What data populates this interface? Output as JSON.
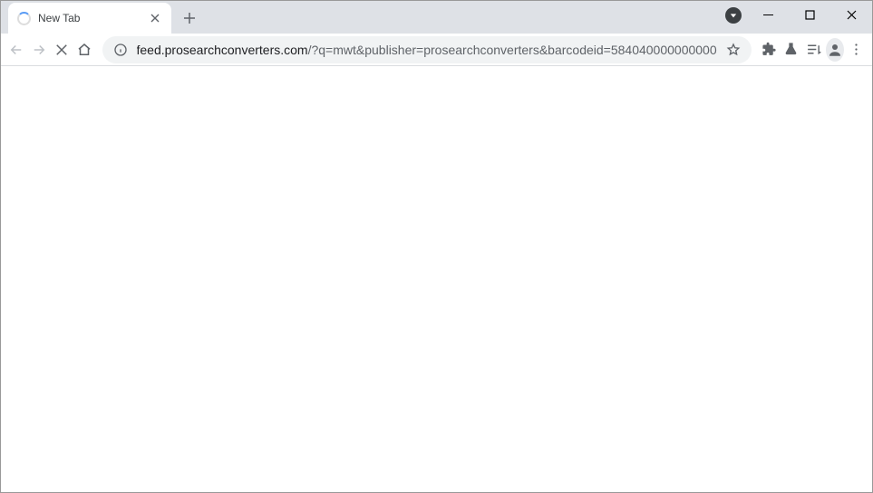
{
  "tab": {
    "title": "New Tab"
  },
  "url": {
    "domain": "feed.prosearchconverters.com",
    "path": "/?q=mwt&publisher=prosearchconverters&barcodeid=584040000000000"
  }
}
